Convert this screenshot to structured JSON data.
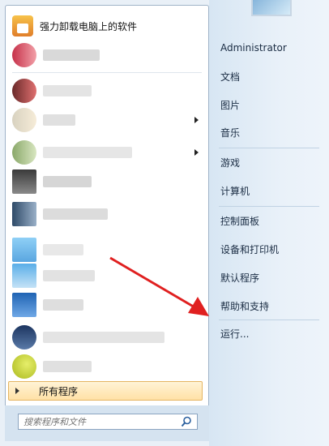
{
  "programs": {
    "pinned": [
      {
        "label": "强力卸载电脑上的软件",
        "icon": "uninstaller-icon",
        "color": "#f0a23a"
      }
    ],
    "recent_blurred": [
      {
        "icon_color": "#e05a6a",
        "has_submenu": false
      },
      {
        "icon_color": "#b04a4a",
        "has_submenu": false
      },
      {
        "icon_color": "#f2e3c7",
        "has_submenu": true
      },
      {
        "icon_color": "#9fc58a",
        "has_submenu": true
      },
      {
        "icon_color": "#4a4a4a",
        "has_submenu": false
      },
      {
        "icon_color": "#3f5a78",
        "has_submenu": false
      },
      {
        "icon_color": "#6cb6ee",
        "has_submenu": false
      },
      {
        "icon_color": "#4aa0e0",
        "has_submenu": false
      },
      {
        "icon_color": "#2b6ab8",
        "has_submenu": false
      },
      {
        "icon_color": "#203a66",
        "has_submenu": false
      },
      {
        "icon_color": "#c9d22a",
        "has_submenu": false
      }
    ]
  },
  "all_programs_label": "所有程序",
  "search": {
    "placeholder": "搜索程序和文件"
  },
  "right_menu": {
    "user": "Administrator",
    "documents": "文档",
    "pictures": "图片",
    "music": "音乐",
    "games": "游戏",
    "computer": "计算机",
    "control_panel": "控制面板",
    "devices_printers": "设备和打印机",
    "default_programs": "默认程序",
    "help_support": "帮助和支持",
    "run": "运行..."
  },
  "colors": {
    "annotation_arrow": "#e02020",
    "all_programs_bg": "#ffe6b0"
  }
}
